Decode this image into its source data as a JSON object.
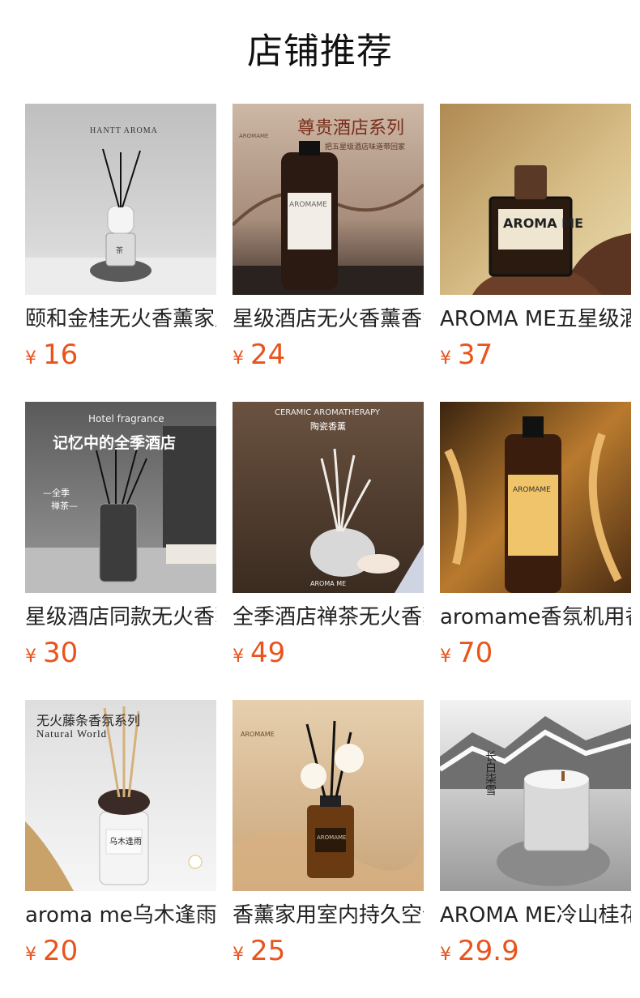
{
  "section": {
    "title": "店铺推荐"
  },
  "currency": "¥",
  "products": [
    {
      "name": "颐和金桂无火香薰家用卧室持久香氛",
      "price": "16",
      "image_text": [
        "HANTT AROMA",
        "茶"
      ]
    },
    {
      "name": "星级酒店无火香薰香氛家用卧室持久",
      "price": "24",
      "image_text": [
        "尊贵酒店系列",
        "把五星级酒店味道带回家",
        "AROMAME",
        "AROMAME"
      ]
    },
    {
      "name": "AROMA ME五星级酒店香薰精油",
      "price": "37",
      "image_text": [
        "AROMA ME"
      ]
    },
    {
      "name": "星级酒店同款无火香薰家用室内",
      "price": "30",
      "image_text": [
        "Hotel fragrance",
        "记忆中的全季酒店",
        "—全季",
        "禅茶—"
      ]
    },
    {
      "name": "全季酒店禅茶无火香薰陶瓷香薰",
      "price": "49",
      "image_text": [
        "CERAMIC AROMATHERAPY",
        "陶瓷香薰",
        "AROMA ME"
      ]
    },
    {
      "name": "aromame香氛机用香薰精油",
      "price": "70",
      "image_text": [
        "AROMAME"
      ]
    },
    {
      "name": "aroma me乌木逢雨无火藤条香薰",
      "price": "20",
      "image_text": [
        "无火藤条香氛系列",
        "Natural World",
        "乌木逢雨"
      ]
    },
    {
      "name": "香薰家用室内持久空气清新剂",
      "price": "25",
      "image_text": [
        "AROMAME",
        "AROMAME"
      ]
    },
    {
      "name": "AROMA ME冷山桂花香薰蜡烛",
      "price": "29.9",
      "image_text": [
        "长白柒雪"
      ]
    }
  ],
  "colors": {
    "price": "#e8541c",
    "title": "#111111"
  }
}
